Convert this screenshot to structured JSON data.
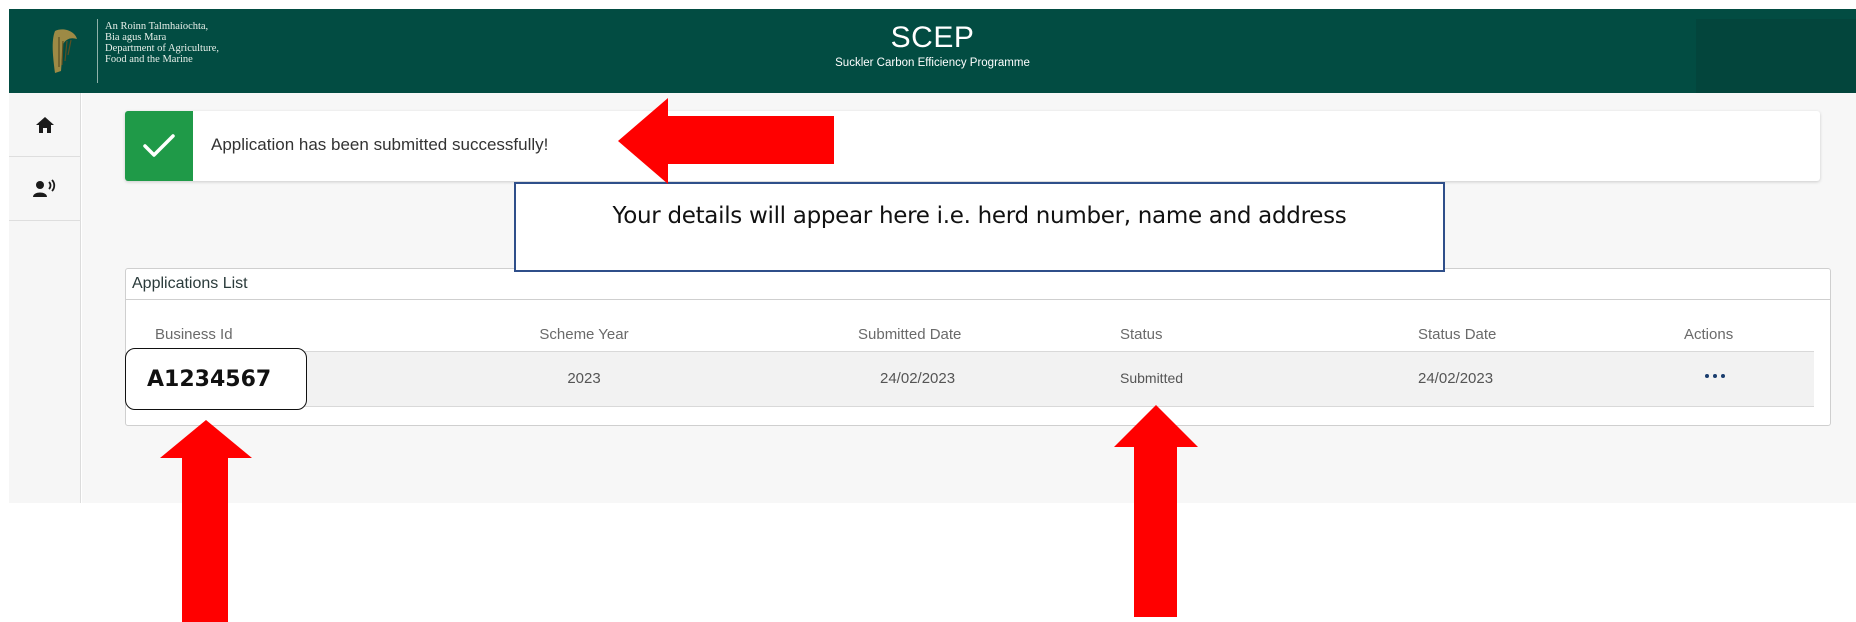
{
  "header": {
    "department_lines": [
      "An Roinn Talmhaíochta,",
      "Bia agus Mara",
      "Department of Agriculture,",
      "Food and the Marine"
    ],
    "app_title": "SCEP",
    "app_subtitle": "Suckler Carbon Efficiency Programme",
    "background": "#024c42"
  },
  "sidebar": {
    "items": [
      {
        "icon": "home-icon"
      },
      {
        "icon": "person-speaking-icon"
      }
    ]
  },
  "success_banner": {
    "message": "Application has been submitted successfully!",
    "icon": "check-icon",
    "color": "#1f9a48"
  },
  "details_note": {
    "text": "Your details will appear here i.e. herd number, name and address"
  },
  "applications_list": {
    "title": "Applications List",
    "columns": [
      "Business Id",
      "Scheme Year",
      "Submitted Date",
      "Status",
      "Status Date",
      "Actions"
    ],
    "rows": [
      {
        "business_id": "A1234567",
        "scheme_year": "2023",
        "submitted_date": "24/02/2023",
        "status": "Submitted",
        "status_date": "24/02/2023",
        "actions_icon": "more-horizontal-icon"
      }
    ]
  },
  "annotation_arrows": {
    "color": "#ff0000",
    "count": 3
  }
}
